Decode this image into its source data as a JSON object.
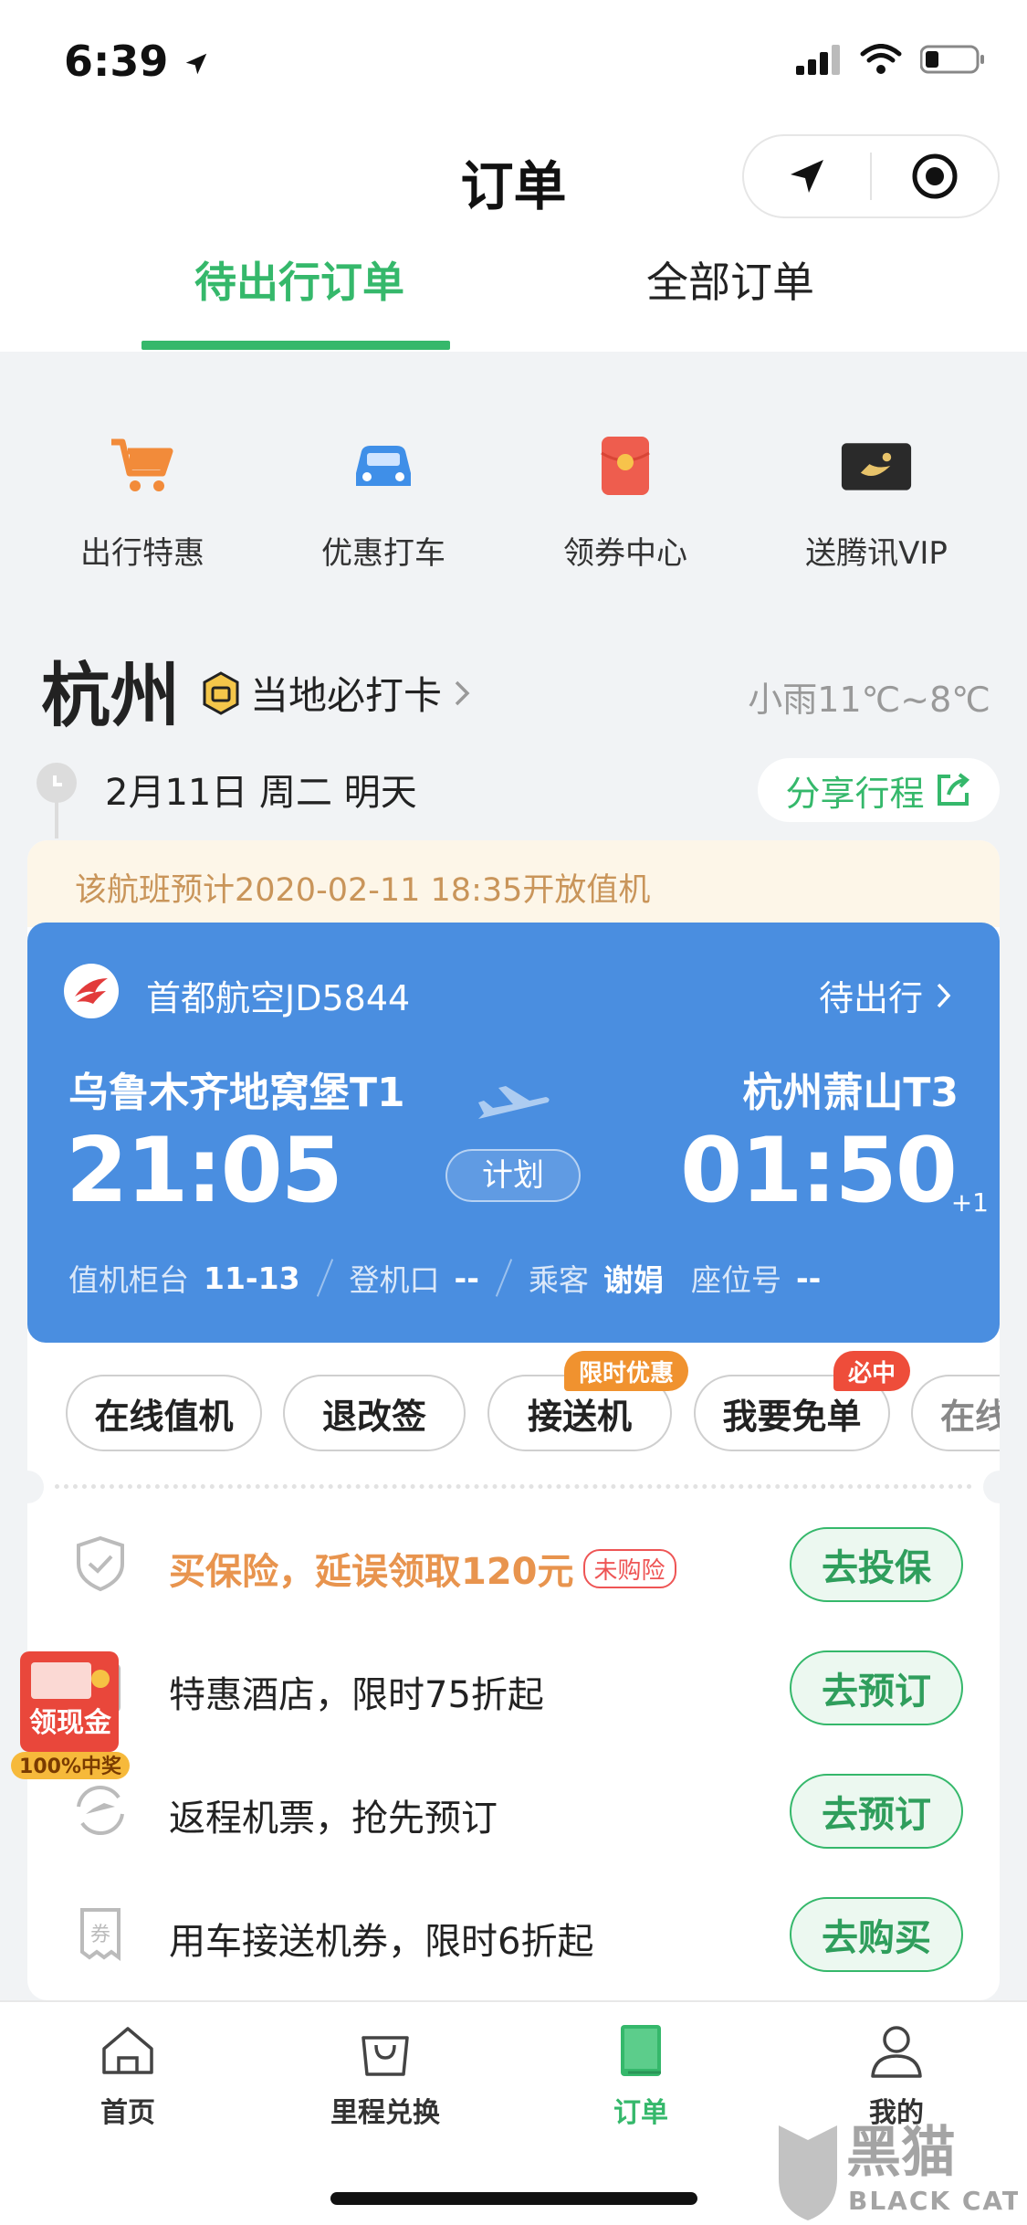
{
  "status_bar": {
    "time": "6:39"
  },
  "header": {
    "title": "订单"
  },
  "tabs": [
    {
      "label": "待出行订单",
      "active": true
    },
    {
      "label": "全部订单",
      "active": false
    }
  ],
  "quick_links": [
    {
      "label": "出行特惠",
      "icon": "cart-icon"
    },
    {
      "label": "优惠打车",
      "icon": "car-icon"
    },
    {
      "label": "领券中心",
      "icon": "red-envelope-icon"
    },
    {
      "label": "送腾讯VIP",
      "icon": "vip-card-icon"
    }
  ],
  "city": {
    "name": "杭州",
    "checkin_label": "当地必打卡",
    "weather": "小雨11℃~8℃"
  },
  "date_row": {
    "date": "2月11日 周二 明天",
    "share_label": "分享行程"
  },
  "notice": "该航班预计2020-02-11 18:35开放值机",
  "flight": {
    "airline": "首都航空JD5844",
    "status": "待出行",
    "departure_airport": "乌鲁木齐地窝堡T1",
    "arrival_airport": "杭州萧山T3",
    "departure_time": "21:05",
    "arrival_time": "01:50",
    "day_offset": "+1",
    "plan_label": "计划",
    "counter_label": "值机柜台",
    "counter_value": "11-13",
    "gate_label": "登机口",
    "gate_value": "--",
    "passenger_label": "乘客",
    "passenger_value": "谢娟",
    "seat_label": "座位号",
    "seat_value": "--"
  },
  "actions": [
    {
      "label": "在线值机",
      "badge": ""
    },
    {
      "label": "退改签",
      "badge": ""
    },
    {
      "label": "接送机",
      "badge": "限时优惠"
    },
    {
      "label": "我要免单",
      "badge": "必中"
    },
    {
      "label": "在线",
      "badge": ""
    }
  ],
  "promos": [
    {
      "text": "买保险，延误领取120元",
      "tag": "未购险",
      "button": "去投保",
      "icon": "shield-icon"
    },
    {
      "text": "特惠酒店，限时75折起",
      "tag": "",
      "button": "去预订",
      "icon": "hotel-icon"
    },
    {
      "text": "返程机票，抢先预订",
      "tag": "",
      "button": "去预订",
      "icon": "return-flight-icon"
    },
    {
      "text": "用车接送机券，限时6折起",
      "tag": "",
      "button": "去购买",
      "icon": "coupon-icon"
    }
  ],
  "coupon_icon_text": "券",
  "float_badge": {
    "title": "领现金",
    "subtitle": "100%中奖"
  },
  "bottom_nav": [
    {
      "label": "首页",
      "icon": "home-icon",
      "active": false
    },
    {
      "label": "里程兑换",
      "icon": "shopping-bag-icon",
      "active": false
    },
    {
      "label": "订单",
      "icon": "order-book-icon",
      "active": true
    },
    {
      "label": "我的",
      "icon": "user-icon",
      "active": false
    }
  ],
  "watermark": {
    "cn": "黑猫",
    "en": "BLACK CAT"
  },
  "colors": {
    "accent": "#35b86b",
    "flight_card": "#4a8ee0",
    "notice_bg": "#fdf6e8",
    "notice_text": "#c9955a"
  }
}
